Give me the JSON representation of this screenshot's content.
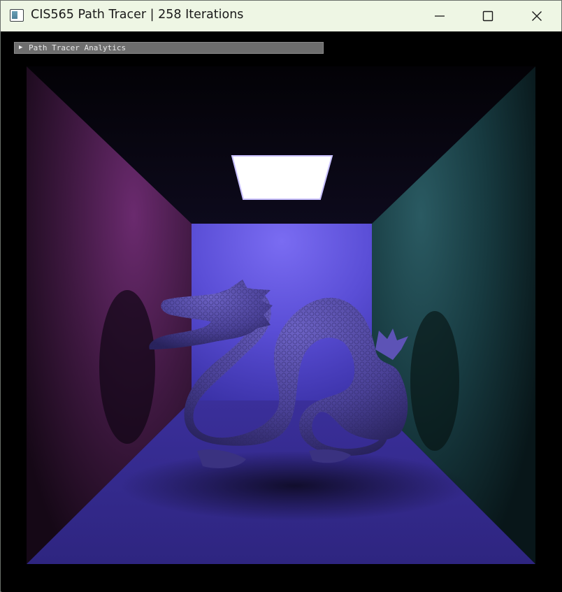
{
  "window": {
    "title": "CIS565 Path Tracer | 258 Iterations",
    "controls": [
      "minimize-icon",
      "maximize-icon",
      "close-icon"
    ]
  },
  "overlay": {
    "collapsed_header_label": "Path Tracer Analytics",
    "expand_icon": "triangle-right-icon"
  },
  "scene": {
    "left_wall_color": "#6a2a6e",
    "right_wall_color": "#2a5a62",
    "back_wall_color": "#6e5fe8",
    "floor_color": "#3a2f90",
    "model_color": "#5c52b0",
    "light_color": "#ffffff"
  }
}
